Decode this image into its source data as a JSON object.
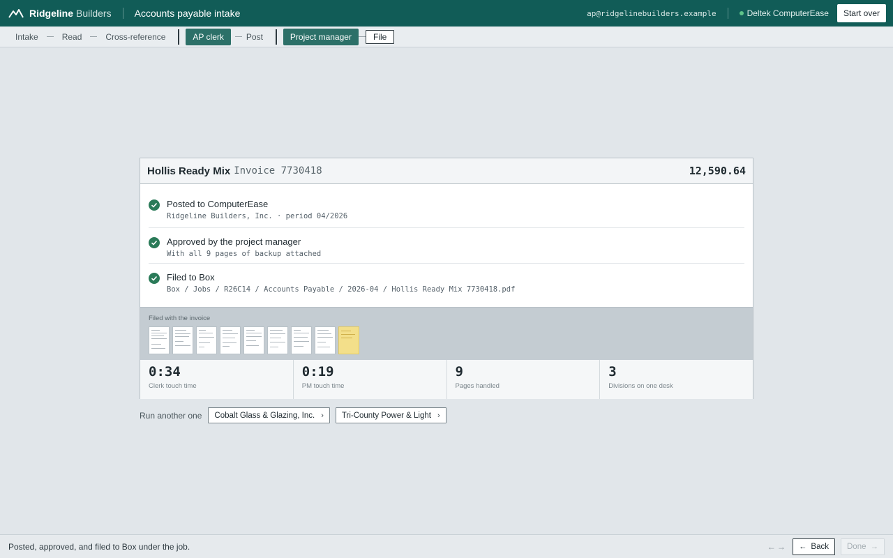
{
  "header": {
    "brand_name": "Ridgeline",
    "brand_sub": "Builders",
    "app_title": "Accounts payable intake",
    "user_email": "ap@ridgelinebuilders.example",
    "system_name": "Deltek ComputerEase",
    "start_over_label": "Start over"
  },
  "steps": {
    "intake": "Intake",
    "read": "Read",
    "crossref": "Cross-reference",
    "ap_clerk": "AP clerk",
    "post": "Post",
    "project_manager": "Project manager",
    "file": "File"
  },
  "invoice": {
    "vendor": "Hollis Ready Mix",
    "label": "Invoice 7730418",
    "amount": "12,590.64"
  },
  "checks": [
    {
      "title": "Posted to ComputerEase",
      "detail": "Ridgeline Builders, Inc. · period 04/2026"
    },
    {
      "title": "Approved by the project manager",
      "detail": "With all 9 pages of backup attached"
    },
    {
      "title": "Filed to Box",
      "detail": "Box / Jobs / R26C14 / Accounts Payable / 2026-04 / Hollis Ready Mix 7730418.pdf"
    }
  ],
  "filed": {
    "label": "Filed with the invoice"
  },
  "stats": [
    {
      "value": "0:34",
      "label": "Clerk touch time"
    },
    {
      "value": "0:19",
      "label": "PM touch time"
    },
    {
      "value": "9",
      "label": "Pages handled"
    },
    {
      "value": "3",
      "label": "Divisions on one desk"
    }
  ],
  "run_another": {
    "label": "Run another one",
    "options": [
      "Cobalt Glass & Glazing, Inc.",
      "Tri-County Power & Light"
    ]
  },
  "footer": {
    "message": "Posted, approved, and filed to Box under the job.",
    "back_label": "Back",
    "done_label": "Done"
  },
  "colors": {
    "header_bg": "#115c57",
    "accent": "#2c7068",
    "success": "#2a7a58"
  }
}
